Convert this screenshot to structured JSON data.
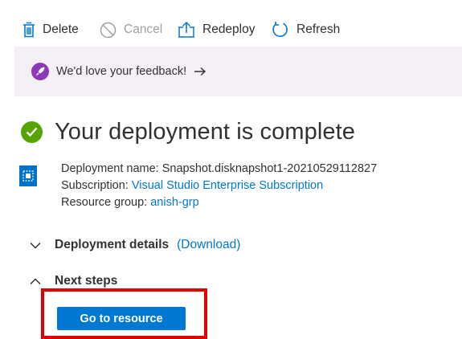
{
  "toolbar": {
    "delete_label": "Delete",
    "cancel_label": "Cancel",
    "redeploy_label": "Redeploy",
    "refresh_label": "Refresh"
  },
  "feedback": {
    "label": "We'd love your feedback!",
    "arrow": "→"
  },
  "title": "Your deployment is complete",
  "deployment": {
    "name_label": "Deployment name:",
    "name_value": "Snapshot.disknapshot1-20210529112827",
    "subscription_label": "Subscription:",
    "subscription_value": "Visual Studio Enterprise Subscription",
    "resource_group_label": "Resource group:",
    "resource_group_value": "anish-grp"
  },
  "sections": {
    "details_title": "Deployment details",
    "details_link": "(Download)",
    "next_title": "Next steps"
  },
  "go_button": "Go to resource",
  "colors": {
    "accent": "#0078d4",
    "success": "#57a300",
    "feedback_bg": "#f4f0f6",
    "rocket": "#8a3ab9",
    "highlight": "#e00000"
  },
  "icons": [
    "trash-icon",
    "cancel-icon",
    "upload-icon",
    "refresh-icon",
    "rocket-icon",
    "arrow-right-icon",
    "check-circle-icon",
    "deployment-resource-icon",
    "chevron-down-icon",
    "chevron-up-icon"
  ]
}
